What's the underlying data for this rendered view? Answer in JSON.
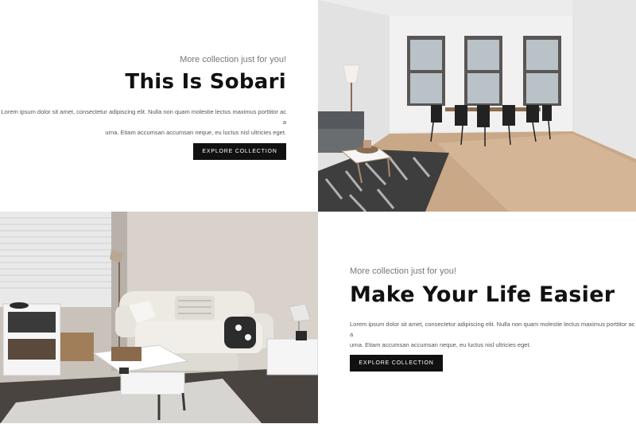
{
  "section1": {
    "kicker": "More collection just for you!",
    "title": "This Is Sobari",
    "body_line1": "Lorem ipsum dolor sit amet, consectetur adipiscing elit. Nulla non quam molestie lectus maximus porttitor ac a",
    "body_line2": "urna. Etiam accumsan accumsan neque, eu luctus nisl ultricies eget.",
    "button_label": "EXPLORE COLLECTION"
  },
  "section2": {
    "kicker": "More collection just for you!",
    "title": "Make Your Life Easier",
    "body_line1": "Lorem ipsum dolor sit amet, consectetur adipiscing elit. Nulla non quam molestie lectus maximus porttitor ac a",
    "body_line2": "urna. Etiam accumsan accumsan neque, eu luctus nisl ultricies eget.",
    "button_label": "EXPLORE COLLECTION"
  },
  "images": {
    "top_right": "dining-room-photo",
    "bottom_left": "living-room-photo"
  },
  "colors": {
    "button_bg": "#111111",
    "title": "#111111",
    "kicker": "#777777"
  }
}
